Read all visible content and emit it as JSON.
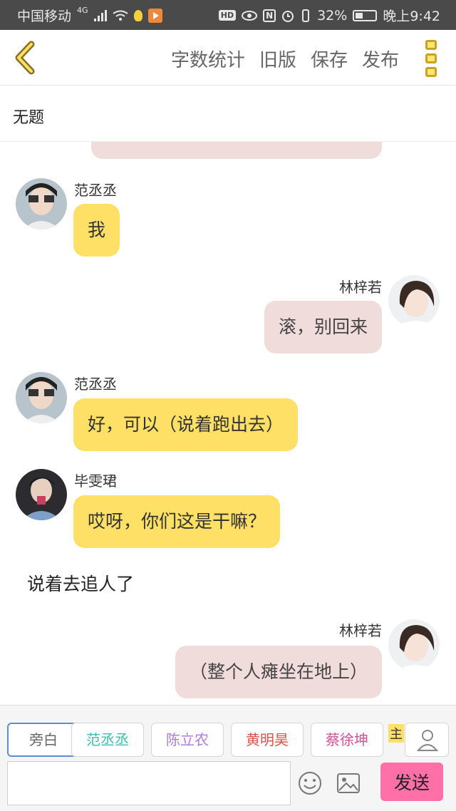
{
  "status_bar": {
    "carrier": "中国移动",
    "network": "4G",
    "battery": "32%",
    "time": "晚上9:42"
  },
  "header": {
    "actions": [
      "字数统计",
      "旧版",
      "保存",
      "发布"
    ]
  },
  "title": "无题",
  "messages": [
    {
      "type": "left",
      "name": "范丞丞",
      "text": "我",
      "color": "yellow"
    },
    {
      "type": "right",
      "name": "林梓若",
      "text": "滚，别回来",
      "color": "pink"
    },
    {
      "type": "left",
      "name": "范丞丞",
      "text": "好，可以（说着跑出去）",
      "color": "yellow"
    },
    {
      "type": "left",
      "name": "毕雯珺",
      "text": "哎呀，你们这是干嘛？",
      "color": "yellow"
    },
    {
      "type": "narration",
      "text": "说着去追人了"
    },
    {
      "type": "right",
      "name": "林梓若",
      "text": "（整个人瘫坐在地上）",
      "color": "pink"
    }
  ],
  "characters": [
    {
      "label": "旁白",
      "color": "#666666",
      "active": true
    },
    {
      "label": "范丞丞",
      "color": "#3bbfb0"
    },
    {
      "label": "陈立农",
      "color": "#b07cd8"
    },
    {
      "label": "黄明昊",
      "color": "#e0504a"
    },
    {
      "label": "蔡徐坤",
      "color": "#d0509a"
    }
  ],
  "main_tag": "主",
  "input": {
    "value": "",
    "placeholder": ""
  },
  "send_label": "发送"
}
